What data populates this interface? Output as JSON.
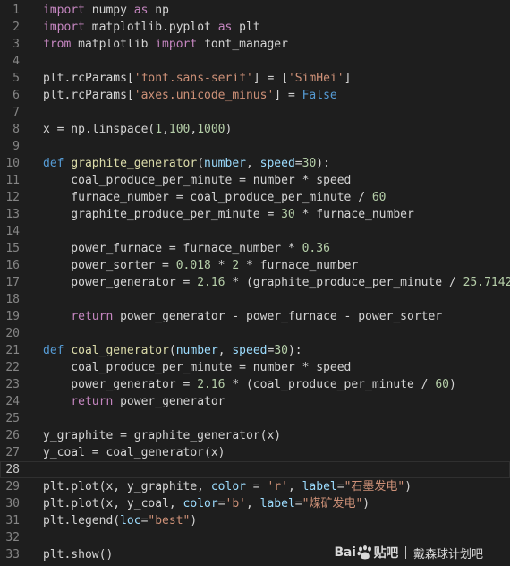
{
  "editor": {
    "lines": [
      {
        "number": "1",
        "tokens": [
          {
            "t": "import",
            "c": "ctl"
          },
          {
            "t": " numpy ",
            "c": "txt"
          },
          {
            "t": "as",
            "c": "ctl"
          },
          {
            "t": " np",
            "c": "txt"
          }
        ]
      },
      {
        "number": "2",
        "tokens": [
          {
            "t": "import",
            "c": "ctl"
          },
          {
            "t": " matplotlib.pyplot ",
            "c": "txt"
          },
          {
            "t": "as",
            "c": "ctl"
          },
          {
            "t": " plt",
            "c": "txt"
          }
        ]
      },
      {
        "number": "3",
        "tokens": [
          {
            "t": "from",
            "c": "ctl"
          },
          {
            "t": " matplotlib ",
            "c": "txt"
          },
          {
            "t": "import",
            "c": "ctl"
          },
          {
            "t": " font_manager",
            "c": "txt"
          }
        ]
      },
      {
        "number": "4",
        "tokens": []
      },
      {
        "number": "5",
        "tokens": [
          {
            "t": "plt.rcParams[",
            "c": "txt"
          },
          {
            "t": "'font.sans-serif'",
            "c": "str"
          },
          {
            "t": "] = [",
            "c": "txt"
          },
          {
            "t": "'SimHei'",
            "c": "str"
          },
          {
            "t": "]",
            "c": "txt"
          }
        ]
      },
      {
        "number": "6",
        "tokens": [
          {
            "t": "plt.rcParams[",
            "c": "txt"
          },
          {
            "t": "'axes.unicode_minus'",
            "c": "str"
          },
          {
            "t": "] = ",
            "c": "txt"
          },
          {
            "t": "False",
            "c": "kw"
          }
        ]
      },
      {
        "number": "7",
        "tokens": []
      },
      {
        "number": "8",
        "tokens": [
          {
            "t": "x = np.linspace(",
            "c": "txt"
          },
          {
            "t": "1",
            "c": "num"
          },
          {
            "t": ",",
            "c": "txt"
          },
          {
            "t": "100",
            "c": "num"
          },
          {
            "t": ",",
            "c": "txt"
          },
          {
            "t": "1000",
            "c": "num"
          },
          {
            "t": ")",
            "c": "txt"
          }
        ]
      },
      {
        "number": "9",
        "tokens": []
      },
      {
        "number": "10",
        "tokens": [
          {
            "t": "def",
            "c": "kw"
          },
          {
            "t": " ",
            "c": "txt"
          },
          {
            "t": "graphite_generator",
            "c": "fn"
          },
          {
            "t": "(",
            "c": "txt"
          },
          {
            "t": "number",
            "c": "prm"
          },
          {
            "t": ", ",
            "c": "txt"
          },
          {
            "t": "speed",
            "c": "prm"
          },
          {
            "t": "=",
            "c": "txt"
          },
          {
            "t": "30",
            "c": "num"
          },
          {
            "t": "):",
            "c": "txt"
          }
        ]
      },
      {
        "number": "11",
        "tokens": [
          {
            "t": "    coal_produce_per_minute = number * speed",
            "c": "txt"
          }
        ]
      },
      {
        "number": "12",
        "tokens": [
          {
            "t": "    furnace_number = coal_produce_per_minute / ",
            "c": "txt"
          },
          {
            "t": "60",
            "c": "num"
          }
        ]
      },
      {
        "number": "13",
        "tokens": [
          {
            "t": "    graphite_produce_per_minute = ",
            "c": "txt"
          },
          {
            "t": "30",
            "c": "num"
          },
          {
            "t": " * furnace_number",
            "c": "txt"
          }
        ]
      },
      {
        "number": "14",
        "tokens": []
      },
      {
        "number": "15",
        "tokens": [
          {
            "t": "    power_furnace = furnace_number * ",
            "c": "txt"
          },
          {
            "t": "0.36",
            "c": "num"
          }
        ]
      },
      {
        "number": "16",
        "tokens": [
          {
            "t": "    power_sorter = ",
            "c": "txt"
          },
          {
            "t": "0.018",
            "c": "num"
          },
          {
            "t": " * ",
            "c": "txt"
          },
          {
            "t": "2",
            "c": "num"
          },
          {
            "t": " * furnace_number",
            "c": "txt"
          }
        ]
      },
      {
        "number": "17",
        "tokens": [
          {
            "t": "    power_generator = ",
            "c": "txt"
          },
          {
            "t": "2.16",
            "c": "num"
          },
          {
            "t": " * (graphite_produce_per_minute / ",
            "c": "txt"
          },
          {
            "t": "25.7142",
            "c": "num"
          },
          {
            "t": ")",
            "c": "txt"
          }
        ]
      },
      {
        "number": "18",
        "tokens": []
      },
      {
        "number": "19",
        "tokens": [
          {
            "t": "    ",
            "c": "txt"
          },
          {
            "t": "return",
            "c": "ctl"
          },
          {
            "t": " power_generator - power_furnace - power_sorter",
            "c": "txt"
          }
        ]
      },
      {
        "number": "20",
        "tokens": []
      },
      {
        "number": "21",
        "tokens": [
          {
            "t": "def",
            "c": "kw"
          },
          {
            "t": " ",
            "c": "txt"
          },
          {
            "t": "coal_generator",
            "c": "fn"
          },
          {
            "t": "(",
            "c": "txt"
          },
          {
            "t": "number",
            "c": "prm"
          },
          {
            "t": ", ",
            "c": "txt"
          },
          {
            "t": "speed",
            "c": "prm"
          },
          {
            "t": "=",
            "c": "txt"
          },
          {
            "t": "30",
            "c": "num"
          },
          {
            "t": "):",
            "c": "txt"
          }
        ]
      },
      {
        "number": "22",
        "tokens": [
          {
            "t": "    coal_produce_per_minute = number * speed",
            "c": "txt"
          }
        ]
      },
      {
        "number": "23",
        "tokens": [
          {
            "t": "    power_generator = ",
            "c": "txt"
          },
          {
            "t": "2.16",
            "c": "num"
          },
          {
            "t": " * (coal_produce_per_minute / ",
            "c": "txt"
          },
          {
            "t": "60",
            "c": "num"
          },
          {
            "t": ")",
            "c": "txt"
          }
        ]
      },
      {
        "number": "24",
        "tokens": [
          {
            "t": "    ",
            "c": "txt"
          },
          {
            "t": "return",
            "c": "ctl"
          },
          {
            "t": " power_generator",
            "c": "txt"
          }
        ]
      },
      {
        "number": "25",
        "tokens": []
      },
      {
        "number": "26",
        "tokens": [
          {
            "t": "y_graphite = graphite_generator(x)",
            "c": "txt"
          }
        ]
      },
      {
        "number": "27",
        "tokens": [
          {
            "t": "y_coal = coal_generator(x)",
            "c": "txt"
          }
        ]
      },
      {
        "number": "28",
        "tokens": [],
        "current": true
      },
      {
        "number": "29",
        "tokens": [
          {
            "t": "plt.plot(x, y_graphite, ",
            "c": "txt"
          },
          {
            "t": "color",
            "c": "prm"
          },
          {
            "t": " = ",
            "c": "txt"
          },
          {
            "t": "'r'",
            "c": "str"
          },
          {
            "t": ", ",
            "c": "txt"
          },
          {
            "t": "label",
            "c": "prm"
          },
          {
            "t": "=",
            "c": "txt"
          },
          {
            "t": "\"石墨发电\"",
            "c": "str"
          },
          {
            "t": ")",
            "c": "txt"
          }
        ]
      },
      {
        "number": "30",
        "tokens": [
          {
            "t": "plt.plot(x, y_coal, ",
            "c": "txt"
          },
          {
            "t": "color",
            "c": "prm"
          },
          {
            "t": "=",
            "c": "txt"
          },
          {
            "t": "'b'",
            "c": "str"
          },
          {
            "t": ", ",
            "c": "txt"
          },
          {
            "t": "label",
            "c": "prm"
          },
          {
            "t": "=",
            "c": "txt"
          },
          {
            "t": "\"煤矿发电\"",
            "c": "str"
          },
          {
            "t": ")",
            "c": "txt"
          }
        ]
      },
      {
        "number": "31",
        "tokens": [
          {
            "t": "plt.legend(",
            "c": "txt"
          },
          {
            "t": "loc",
            "c": "prm"
          },
          {
            "t": "=",
            "c": "txt"
          },
          {
            "t": "\"best\"",
            "c": "str"
          },
          {
            "t": ")",
            "c": "txt"
          }
        ]
      },
      {
        "number": "32",
        "tokens": []
      },
      {
        "number": "33",
        "tokens": [
          {
            "t": "plt.show()",
            "c": "txt"
          }
        ]
      }
    ]
  },
  "watermark": {
    "brand_left": "Bai",
    "brand_right": "贴吧",
    "paw_icon": "paw-icon",
    "forum": "戴森球计划吧"
  },
  "colors": {
    "background": "#1e1e1e",
    "line_number": "#858585",
    "keyword": "#569cd6",
    "control": "#c586c0",
    "function": "#dcdcaa",
    "parameter": "#9cdcfe",
    "string": "#ce9178",
    "number": "#b5cea8",
    "text": "#d4d4d4"
  }
}
